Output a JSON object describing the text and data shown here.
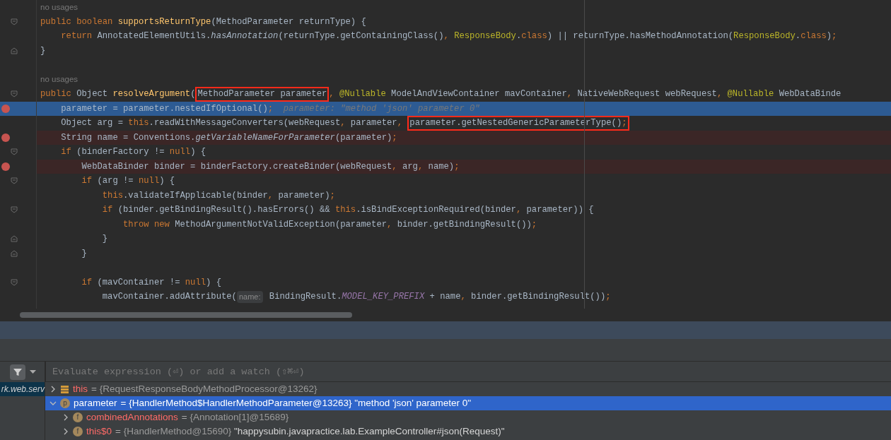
{
  "editor": {
    "lines": [
      {
        "kind": "usages",
        "segments": [
          {
            "kind": "usages",
            "text": "no usages"
          }
        ]
      },
      {
        "kind": "normal",
        "fold_start": true,
        "segments": [
          {
            "kind": "kw",
            "text": "public boolean "
          },
          {
            "kind": "decl",
            "text": "supportsReturnType"
          },
          {
            "kind": "plain",
            "text": "(MethodParameter returnType) {"
          }
        ]
      },
      {
        "kind": "normal",
        "segments": [
          {
            "kind": "kw",
            "text": "    return "
          },
          {
            "kind": "plain",
            "text": "AnnotatedElementUtils."
          },
          {
            "kind": "static",
            "text": "hasAnnotation"
          },
          {
            "kind": "plain",
            "text": "(returnType.getContainingClass()"
          },
          {
            "kind": "kw",
            "text": ", "
          },
          {
            "kind": "cls",
            "text": "ResponseBody"
          },
          {
            "kind": "plain",
            "text": "."
          },
          {
            "kind": "kw",
            "text": "class"
          },
          {
            "kind": "plain",
            "text": ") || returnType.hasMethodAnnotation("
          },
          {
            "kind": "cls",
            "text": "ResponseBody"
          },
          {
            "kind": "plain",
            "text": "."
          },
          {
            "kind": "kw",
            "text": "class"
          },
          {
            "kind": "plain",
            "text": ")"
          },
          {
            "kind": "kw",
            "text": ";"
          }
        ]
      },
      {
        "kind": "normal",
        "fold_end": true,
        "segments": [
          {
            "kind": "plain",
            "text": "}"
          }
        ]
      },
      {
        "kind": "normal"
      },
      {
        "kind": "usages",
        "segments": [
          {
            "kind": "usages",
            "text": "no usages"
          }
        ]
      },
      {
        "kind": "normal",
        "fold_start": true,
        "segments": [
          {
            "kind": "kw",
            "text": "public "
          },
          {
            "kind": "plain",
            "text": "Object "
          },
          {
            "kind": "decl",
            "text": "resolveArgument"
          },
          {
            "kind": "plain",
            "text": "("
          },
          {
            "kind": "plain",
            "text": "MethodParameter parameter",
            "boxed": true
          },
          {
            "kind": "kw",
            "text": ", "
          },
          {
            "kind": "ann",
            "text": "@Nullable "
          },
          {
            "kind": "plain",
            "text": "ModelAndViewContainer mavContainer"
          },
          {
            "kind": "kw",
            "text": ", "
          },
          {
            "kind": "plain",
            "text": "NativeWebRequest webRequest"
          },
          {
            "kind": "kw",
            "text": ", "
          },
          {
            "kind": "ann",
            "text": "@Nullable "
          },
          {
            "kind": "plain",
            "text": "WebDataBinde"
          }
        ]
      },
      {
        "kind": "execution",
        "breakpoint": true,
        "segments": [
          {
            "kind": "plain",
            "text": "    parameter = parameter.nestedIfOptional()"
          },
          {
            "kind": "kw",
            "text": ";"
          },
          {
            "kind": "hint",
            "text": "  parameter: \"method 'json' parameter 0\""
          }
        ]
      },
      {
        "kind": "normal",
        "segments": [
          {
            "kind": "plain",
            "text": "    Object arg = "
          },
          {
            "kind": "kw",
            "text": "this"
          },
          {
            "kind": "plain",
            "text": ".readWithMessageConverters(webRequest"
          },
          {
            "kind": "kw",
            "text": ", "
          },
          {
            "kind": "plain",
            "text": "parameter"
          },
          {
            "kind": "kw",
            "text": ", "
          },
          {
            "kind": "plain",
            "text": "parameter.getNestedGenericParameterType()",
            "boxed": true
          },
          {
            "kind": "kw",
            "text": ";",
            "boxed": true
          }
        ]
      },
      {
        "kind": "breakpoint",
        "breakpoint": true,
        "segments": [
          {
            "kind": "plain",
            "text": "    String name = Conventions."
          },
          {
            "kind": "static",
            "text": "getVariableNameForParameter"
          },
          {
            "kind": "plain",
            "text": "(parameter)"
          },
          {
            "kind": "kw",
            "text": ";"
          }
        ]
      },
      {
        "kind": "normal",
        "fold_start": true,
        "segments": [
          {
            "kind": "kw",
            "text": "    if "
          },
          {
            "kind": "plain",
            "text": "(binderFactory != "
          },
          {
            "kind": "kw",
            "text": "null"
          },
          {
            "kind": "plain",
            "text": ") {"
          }
        ]
      },
      {
        "kind": "breakpoint",
        "breakpoint": true,
        "segments": [
          {
            "kind": "plain",
            "text": "        WebDataBinder binder = binderFactory.createBinder(webRequest"
          },
          {
            "kind": "kw",
            "text": ", "
          },
          {
            "kind": "plain",
            "text": "arg"
          },
          {
            "kind": "kw",
            "text": ", "
          },
          {
            "kind": "plain",
            "text": "name)"
          },
          {
            "kind": "kw",
            "text": ";"
          }
        ]
      },
      {
        "kind": "normal",
        "fold_start": true,
        "segments": [
          {
            "kind": "kw",
            "text": "        if "
          },
          {
            "kind": "plain",
            "text": "(arg != "
          },
          {
            "kind": "kw",
            "text": "null"
          },
          {
            "kind": "plain",
            "text": ") {"
          }
        ]
      },
      {
        "kind": "normal",
        "segments": [
          {
            "kind": "kw",
            "text": "            this"
          },
          {
            "kind": "plain",
            "text": ".validateIfApplicable(binder"
          },
          {
            "kind": "kw",
            "text": ", "
          },
          {
            "kind": "plain",
            "text": "parameter)"
          },
          {
            "kind": "kw",
            "text": ";"
          }
        ]
      },
      {
        "kind": "normal",
        "fold_start": true,
        "segments": [
          {
            "kind": "kw",
            "text": "            if "
          },
          {
            "kind": "plain",
            "text": "(binder.getBindingResult().hasErrors() && "
          },
          {
            "kind": "kw",
            "text": "this"
          },
          {
            "kind": "plain",
            "text": ".isBindExceptionRequired(binder"
          },
          {
            "kind": "kw",
            "text": ", "
          },
          {
            "kind": "plain",
            "text": "parameter)) {"
          }
        ]
      },
      {
        "kind": "normal",
        "segments": [
          {
            "kind": "kw",
            "text": "                throw new "
          },
          {
            "kind": "plain",
            "text": "MethodArgumentNotValidException(parameter"
          },
          {
            "kind": "kw",
            "text": ", "
          },
          {
            "kind": "plain",
            "text": "binder.getBindingResult())"
          },
          {
            "kind": "kw",
            "text": ";"
          }
        ]
      },
      {
        "kind": "normal",
        "fold_end": true,
        "segments": [
          {
            "kind": "plain",
            "text": "            }"
          }
        ]
      },
      {
        "kind": "normal",
        "fold_end": true,
        "segments": [
          {
            "kind": "plain",
            "text": "        }"
          }
        ]
      },
      {
        "kind": "normal"
      },
      {
        "kind": "normal",
        "fold_start": true,
        "segments": [
          {
            "kind": "kw",
            "text": "        if "
          },
          {
            "kind": "plain",
            "text": "(mavContainer != "
          },
          {
            "kind": "kw",
            "text": "null"
          },
          {
            "kind": "plain",
            "text": ") {"
          }
        ]
      },
      {
        "kind": "normal",
        "segments": [
          {
            "kind": "plain",
            "text": "            mavContainer.addAttribute("
          },
          {
            "kind": "inlay",
            "text": "name:"
          },
          {
            "kind": "plain",
            "text": " BindingResult."
          },
          {
            "kind": "const",
            "text": "MODEL_KEY_PREFIX"
          },
          {
            "kind": "plain",
            "text": " + name"
          },
          {
            "kind": "kw",
            "text": ", "
          },
          {
            "kind": "plain",
            "text": "binder.getBindingResult())"
          },
          {
            "kind": "kw",
            "text": ";"
          }
        ]
      }
    ]
  },
  "debugger": {
    "frames": [
      {
        "text": "rk.web.serv",
        "selected": true
      }
    ],
    "evaluate": {
      "placeholder": "Evaluate expression (⏎) or add a watch (⇧⌘⏎)"
    },
    "variables": [
      {
        "kind": "stack",
        "name": "this",
        "operator": "=",
        "ref": "{RequestResponseBodyMethodProcessor@13262}",
        "expanded": false,
        "selected": false
      },
      {
        "kind": "letter",
        "letter": "p",
        "name": "parameter",
        "operator": "=",
        "ref": "{HandlerMethod$HandlerMethodParameter@13263}",
        "text": "\"method 'json' parameter 0\"",
        "expanded": true,
        "selected": true,
        "children": [
          {
            "kind": "letter",
            "letter": "f",
            "name": "combinedAnnotations",
            "operator": "=",
            "ref": "{Annotation[1]@15689}",
            "expanded": false,
            "selected": false
          },
          {
            "kind": "letter",
            "letter": "f",
            "name": "this$0",
            "operator": "=",
            "ref": "{HandlerMethod@15690}",
            "text": "\"happysubin.javapractice.lab.ExampleController#json(Request)\"",
            "expanded": false,
            "selected": false
          }
        ]
      }
    ]
  }
}
